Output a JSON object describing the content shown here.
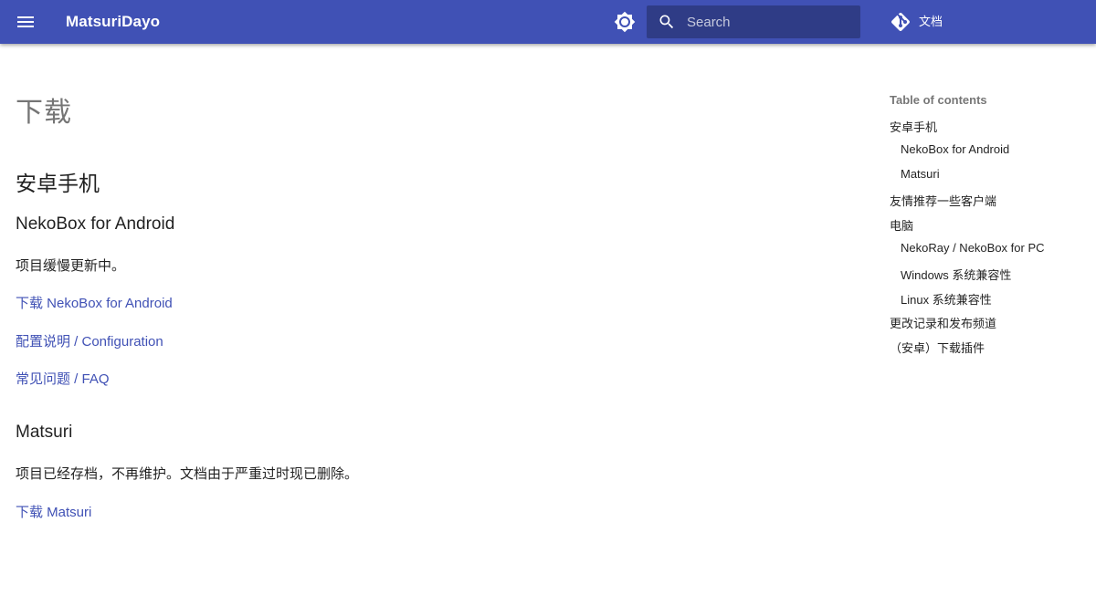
{
  "header": {
    "site_title": "MatsuriDayo",
    "search_placeholder": "Search",
    "repo_label": "文档"
  },
  "page": {
    "title": "下载",
    "sections": {
      "android_heading": "安卓手机",
      "nekobox_heading": "NekoBox for Android",
      "nekobox_status": "项目缓慢更新中。",
      "nekobox_links": [
        "下载 NekoBox for Android",
        "配置说明 / Configuration",
        "常见问题 / FAQ"
      ],
      "matsuri_heading": "Matsuri",
      "matsuri_status": "项目已经存档，不再维护。文档由于严重过时现已删除。",
      "matsuri_link": "下载 Matsuri"
    }
  },
  "toc": {
    "title": "Table of contents",
    "items": [
      "安卓手机",
      "NekoBox for Android",
      "Matsuri",
      "友情推荐一些客户端",
      "电脑",
      "NekoRay / NekoBox for PC",
      "Windows 系统兼容性",
      "Linux 系统兼容性",
      "更改记录和发布频道",
      "（安卓）下载插件"
    ]
  },
  "colors": {
    "primary": "#4051b5",
    "link": "#4051b5",
    "muted_text": "#0000008a"
  },
  "icons": [
    "menu-icon",
    "brightness-icon",
    "search-icon",
    "git-icon"
  ]
}
